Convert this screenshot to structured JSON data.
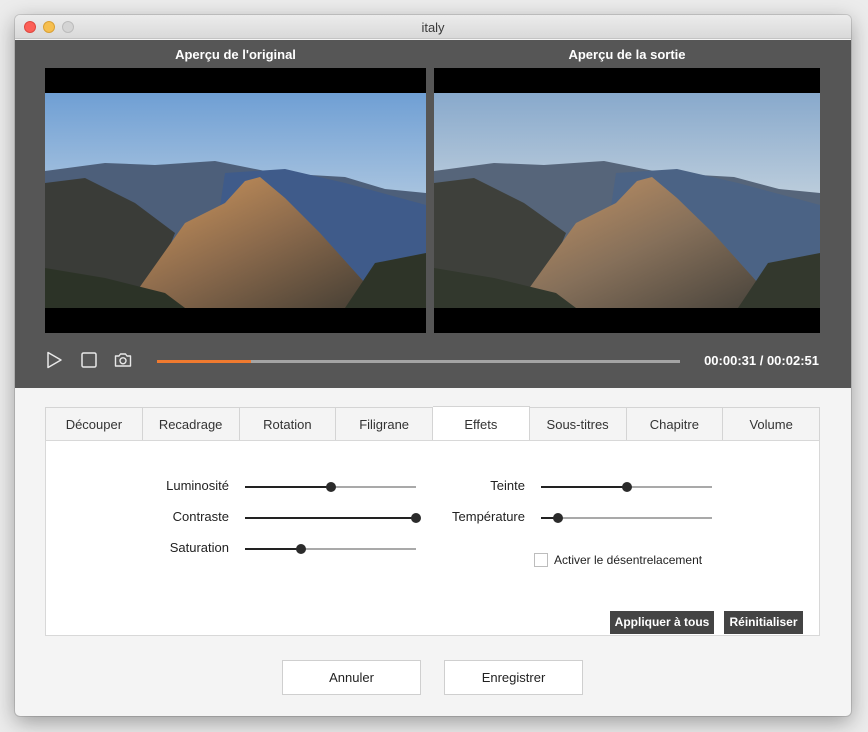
{
  "window": {
    "title": "italy"
  },
  "preview": {
    "original_label": "Aperçu de l'original",
    "output_label": "Aperçu de la sortie",
    "time": "00:00:31 / 00:02:51",
    "progress": 0.18,
    "controls": [
      "play-icon",
      "stop-icon",
      "camera-icon"
    ]
  },
  "tabs": [
    {
      "label": "Découper",
      "active": false
    },
    {
      "label": "Recadrage",
      "active": false
    },
    {
      "label": "Rotation",
      "active": false
    },
    {
      "label": "Filigrane",
      "active": false
    },
    {
      "label": "Effets",
      "active": true
    },
    {
      "label": "Sous-titres",
      "active": false
    },
    {
      "label": "Chapitre",
      "active": false
    },
    {
      "label": "Volume",
      "active": false
    }
  ],
  "effects": {
    "sliders": [
      {
        "label": "Luminosité",
        "value": 0.5
      },
      {
        "label": "Contraste",
        "value": 1.0
      },
      {
        "label": "Saturation",
        "value": 0.33
      },
      {
        "label": "Teinte",
        "value": 0.5
      },
      {
        "label": "Température",
        "value": 0.1
      }
    ],
    "deinterlace_label": "Activer le désentrelacement",
    "deinterlace_checked": false,
    "apply_all": "Appliquer à tous",
    "reset": "Réinitialiser"
  },
  "footer": {
    "cancel": "Annuler",
    "save": "Enregistrer"
  },
  "colors": {
    "accent": "#f07a2f",
    "dark_panel": "#565656",
    "button_dark": "#444444"
  }
}
